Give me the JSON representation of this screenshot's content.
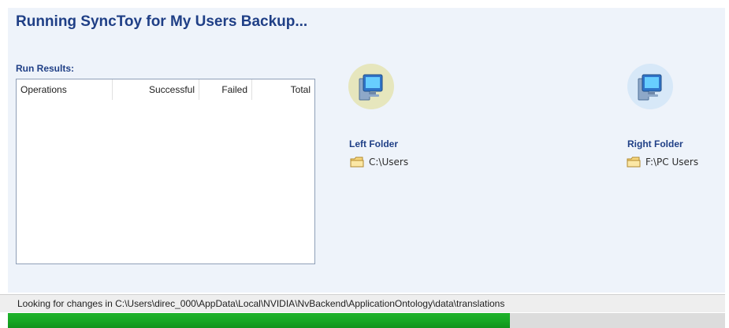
{
  "header": {
    "title": "Running SyncToy for My Users Backup..."
  },
  "run_results": {
    "label": "Run Results:",
    "columns": [
      "Operations",
      "Successful",
      "Failed",
      "Total"
    ],
    "rows": []
  },
  "left_folder": {
    "heading": "Left Folder",
    "path": "C:\\Users",
    "icon": "computer-icon"
  },
  "right_folder": {
    "heading": "Right Folder",
    "path": "F:\\PC Users",
    "icon": "computer-icon"
  },
  "status": {
    "text": "Looking for changes in C:\\Users\\direc_000\\AppData\\Local\\NVIDIA\\NvBackend\\ApplicationOntology\\data\\translations"
  },
  "progress": {
    "fraction": 0.7
  },
  "colors": {
    "accent": "#1f3f86",
    "panel_background": "#eef3fa",
    "progress_green": "#16a623"
  }
}
